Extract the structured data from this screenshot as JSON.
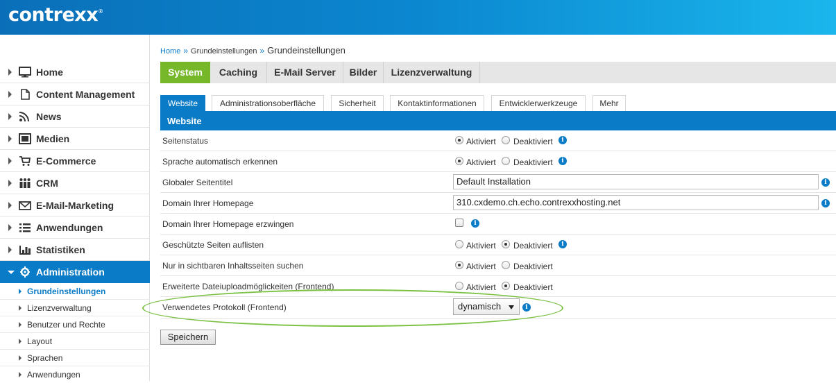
{
  "app": {
    "logo": "contrexx",
    "logo_mark": "®"
  },
  "sidebar": {
    "items": [
      {
        "label": "Home",
        "icon": "monitor-icon"
      },
      {
        "label": "Content Management",
        "icon": "document-icon"
      },
      {
        "label": "News",
        "icon": "rss-icon"
      },
      {
        "label": "Medien",
        "icon": "media-icon"
      },
      {
        "label": "E-Commerce",
        "icon": "cart-icon"
      },
      {
        "label": "CRM",
        "icon": "people-icon"
      },
      {
        "label": "E-Mail-Marketing",
        "icon": "envelope-icon"
      },
      {
        "label": "Anwendungen",
        "icon": "list-icon"
      },
      {
        "label": "Statistiken",
        "icon": "bar-chart-icon"
      },
      {
        "label": "Administration",
        "icon": "gear-icon",
        "active": true
      }
    ],
    "subitems": [
      {
        "label": "Grundeinstellungen",
        "active": true
      },
      {
        "label": "Lizenzverwaltung"
      },
      {
        "label": "Benutzer und Rechte"
      },
      {
        "label": "Layout"
      },
      {
        "label": "Sprachen"
      },
      {
        "label": "Anwendungen"
      }
    ]
  },
  "breadcrumb": {
    "home": "Home",
    "sep": "»",
    "mid": "Grundeinstellungen",
    "current": "Grundeinstellungen"
  },
  "main_tabs": [
    "System",
    "Caching",
    "E-Mail Server",
    "Bilder",
    "Lizenzverwaltung"
  ],
  "sub_tabs": [
    "Website",
    "Administrationsoberfläche",
    "Sicherheit",
    "Kontaktinformationen",
    "Entwicklerwerkzeuge",
    "Mehr"
  ],
  "section_title": "Website",
  "options": {
    "on": "Aktiviert",
    "off": "Deaktiviert"
  },
  "rows": [
    {
      "label": "Seitenstatus",
      "type": "radio",
      "value": "Aktiviert"
    },
    {
      "label": "Sprache automatisch erkennen",
      "type": "radio",
      "value": "Aktiviert"
    },
    {
      "label": "Globaler Seitentitel",
      "type": "text",
      "value": "Default Installation"
    },
    {
      "label": "Domain Ihrer Homepage",
      "type": "text",
      "value": "310.cxdemo.ch.echo.contrexxhosting.net"
    },
    {
      "label": "Domain Ihrer Homepage erzwingen",
      "type": "checkbox",
      "checked": false
    },
    {
      "label": "Geschützte Seiten auflisten",
      "type": "radio",
      "value": "Deaktiviert"
    },
    {
      "label": "Nur in sichtbaren Inhaltsseiten suchen",
      "type": "radio",
      "value": "Aktiviert"
    },
    {
      "label": "Erweiterte Dateiuploadmöglickeiten (Frontend)",
      "type": "radio",
      "value": "Deaktiviert"
    },
    {
      "label": "Verwendetes Protokoll (Frontend)",
      "type": "select",
      "value": "dynamisch"
    }
  ],
  "info_glyph": "i",
  "save_label": "Speichern",
  "colors": {
    "accent": "#0a7bc7",
    "active_tab": "#77b82b",
    "highlight": "#7bc142"
  }
}
